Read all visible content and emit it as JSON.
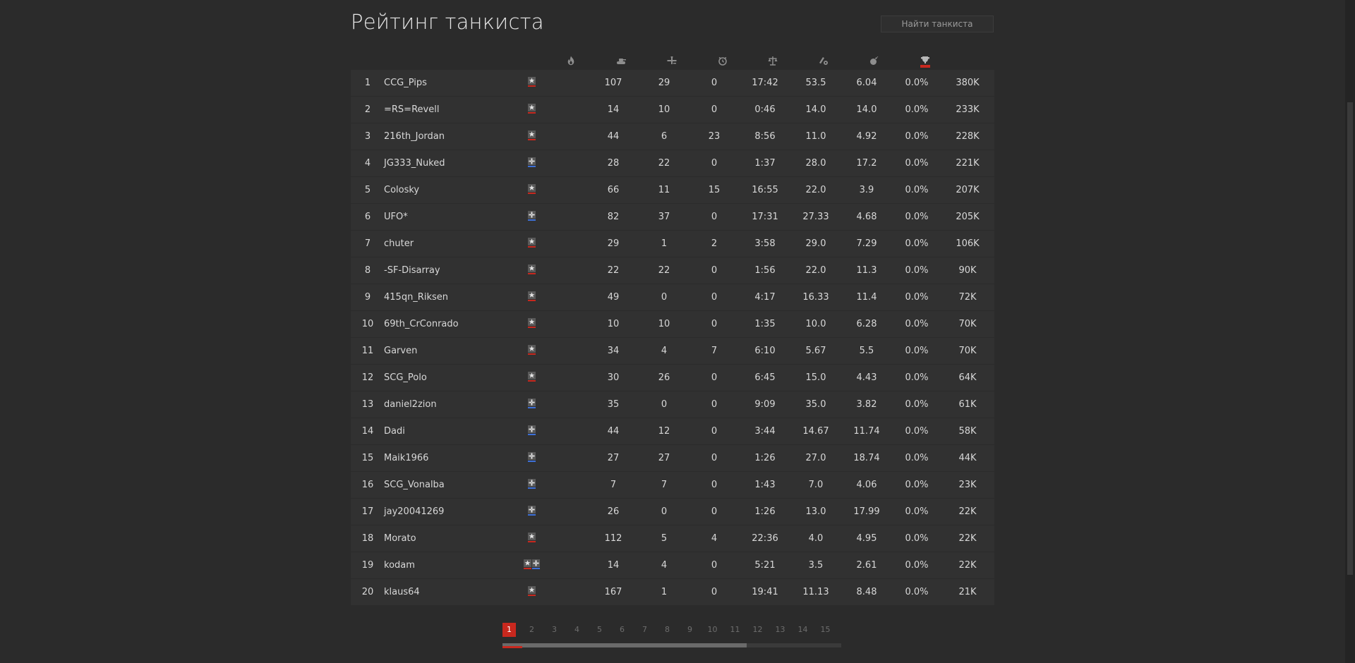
{
  "page": {
    "title": "Рейтинг танкиста"
  },
  "search": {
    "placeholder": "Найти танкиста",
    "value": ""
  },
  "header_icons": [
    "flame-icon",
    "tank-kill-icon",
    "plane-kill-icon",
    "clock-icon",
    "scales-icon",
    "ratio-icon",
    "bomb-icon",
    "trophy-icon"
  ],
  "sort_column": "trophy-icon",
  "colors": {
    "accent": "#c8281e",
    "allied": "#c8281e",
    "axis": "#3d6fd6"
  },
  "rows": [
    {
      "rank": "1",
      "name": "CCG_Pips",
      "side": [
        "allied"
      ],
      "v": [
        "107",
        "29",
        "0",
        "17:42",
        "53.5",
        "6.04",
        "0.0%",
        "380K"
      ]
    },
    {
      "rank": "2",
      "name": "=RS=Revell",
      "side": [
        "allied"
      ],
      "v": [
        "14",
        "10",
        "0",
        "0:46",
        "14.0",
        "14.0",
        "0.0%",
        "233K"
      ]
    },
    {
      "rank": "3",
      "name": "216th_Jordan",
      "side": [
        "allied"
      ],
      "v": [
        "44",
        "6",
        "23",
        "8:56",
        "11.0",
        "4.92",
        "0.0%",
        "228K"
      ]
    },
    {
      "rank": "4",
      "name": "JG333_Nuked",
      "side": [
        "axis"
      ],
      "v": [
        "28",
        "22",
        "0",
        "1:37",
        "28.0",
        "17.2",
        "0.0%",
        "221K"
      ]
    },
    {
      "rank": "5",
      "name": "Colosky",
      "side": [
        "allied"
      ],
      "v": [
        "66",
        "11",
        "15",
        "16:55",
        "22.0",
        "3.9",
        "0.0%",
        "207K"
      ]
    },
    {
      "rank": "6",
      "name": "UFO*",
      "side": [
        "axis"
      ],
      "v": [
        "82",
        "37",
        "0",
        "17:31",
        "27.33",
        "4.68",
        "0.0%",
        "205K"
      ]
    },
    {
      "rank": "7",
      "name": "chuter",
      "side": [
        "allied"
      ],
      "v": [
        "29",
        "1",
        "2",
        "3:58",
        "29.0",
        "7.29",
        "0.0%",
        "106K"
      ]
    },
    {
      "rank": "8",
      "name": "-SF-Disarray",
      "side": [
        "allied"
      ],
      "v": [
        "22",
        "22",
        "0",
        "1:56",
        "22.0",
        "11.3",
        "0.0%",
        "90K"
      ]
    },
    {
      "rank": "9",
      "name": "415qn_Riksen",
      "side": [
        "allied"
      ],
      "v": [
        "49",
        "0",
        "0",
        "4:17",
        "16.33",
        "11.4",
        "0.0%",
        "72K"
      ]
    },
    {
      "rank": "10",
      "name": "69th_CrConrado",
      "side": [
        "allied"
      ],
      "v": [
        "10",
        "10",
        "0",
        "1:35",
        "10.0",
        "6.28",
        "0.0%",
        "70K"
      ]
    },
    {
      "rank": "11",
      "name": "Garven",
      "side": [
        "allied"
      ],
      "v": [
        "34",
        "4",
        "7",
        "6:10",
        "5.67",
        "5.5",
        "0.0%",
        "70K"
      ]
    },
    {
      "rank": "12",
      "name": "SCG_Polo",
      "side": [
        "allied"
      ],
      "v": [
        "30",
        "26",
        "0",
        "6:45",
        "15.0",
        "4.43",
        "0.0%",
        "64K"
      ]
    },
    {
      "rank": "13",
      "name": "daniel2zion",
      "side": [
        "axis"
      ],
      "v": [
        "35",
        "0",
        "0",
        "9:09",
        "35.0",
        "3.82",
        "0.0%",
        "61K"
      ]
    },
    {
      "rank": "14",
      "name": "Dadi",
      "side": [
        "axis"
      ],
      "v": [
        "44",
        "12",
        "0",
        "3:44",
        "14.67",
        "11.74",
        "0.0%",
        "58K"
      ]
    },
    {
      "rank": "15",
      "name": "Maik1966",
      "side": [
        "axis"
      ],
      "v": [
        "27",
        "27",
        "0",
        "1:26",
        "27.0",
        "18.74",
        "0.0%",
        "44K"
      ]
    },
    {
      "rank": "16",
      "name": "SCG_Vonalba",
      "side": [
        "axis"
      ],
      "v": [
        "7",
        "7",
        "0",
        "1:43",
        "7.0",
        "4.06",
        "0.0%",
        "23K"
      ]
    },
    {
      "rank": "17",
      "name": "jay20041269",
      "side": [
        "axis"
      ],
      "v": [
        "26",
        "0",
        "0",
        "1:26",
        "13.0",
        "17.99",
        "0.0%",
        "22K"
      ]
    },
    {
      "rank": "18",
      "name": "Morato",
      "side": [
        "allied"
      ],
      "v": [
        "112",
        "5",
        "4",
        "22:36",
        "4.0",
        "4.95",
        "0.0%",
        "22K"
      ]
    },
    {
      "rank": "19",
      "name": "kodam",
      "side": [
        "allied",
        "axis"
      ],
      "v": [
        "14",
        "4",
        "0",
        "5:21",
        "3.5",
        "2.61",
        "0.0%",
        "22K"
      ]
    },
    {
      "rank": "20",
      "name": "klaus64",
      "side": [
        "allied"
      ],
      "v": [
        "167",
        "1",
        "0",
        "19:41",
        "11.13",
        "8.48",
        "0.0%",
        "21K"
      ]
    }
  ],
  "pagination": {
    "pages": [
      "1",
      "2",
      "3",
      "4",
      "5",
      "6",
      "7",
      "8",
      "9",
      "10",
      "11",
      "12",
      "13",
      "14",
      "15"
    ],
    "current": "1",
    "scroll_fraction": 0.72
  }
}
